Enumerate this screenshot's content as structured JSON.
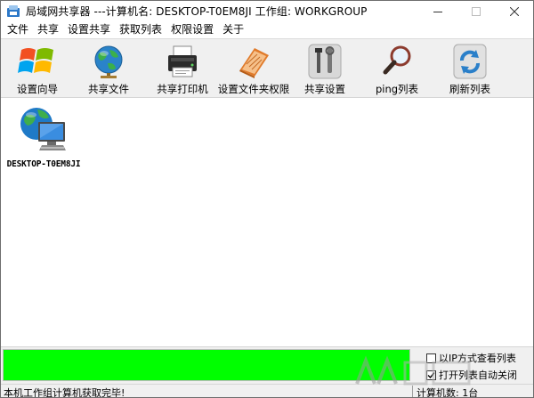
{
  "window": {
    "title": "局域网共享器 ---计算机名: DESKTOP-T0EM8JI  工作组: WORKGROUP"
  },
  "menu": [
    "文件",
    "共享",
    "设置共享",
    "获取列表",
    "权限设置",
    "关于"
  ],
  "toolbar": [
    {
      "label": "设置向导",
      "icon": "windows-logo-icon"
    },
    {
      "label": "共享文件",
      "icon": "globe-icon"
    },
    {
      "label": "共享打印机",
      "icon": "printer-icon"
    },
    {
      "label": "设置文件夹权限",
      "icon": "folder-book-icon"
    },
    {
      "label": "共享设置",
      "icon": "tools-icon"
    },
    {
      "label": "ping列表",
      "icon": "magnifier-icon"
    },
    {
      "label": "刷新列表",
      "icon": "refresh-icon"
    }
  ],
  "computers": [
    {
      "name": "DESKTOP-T0EM8JI",
      "icon": "networked-computer-icon"
    }
  ],
  "progress": {
    "value": 1.0,
    "color": "#00ff00"
  },
  "options": [
    {
      "label": "以IP方式查看列表",
      "checked": false
    },
    {
      "label": "打开列表自动关闭",
      "checked": true
    }
  ],
  "status": {
    "message": "本机工作组计算机获取完毕!",
    "count": "计算机数: 1台"
  }
}
